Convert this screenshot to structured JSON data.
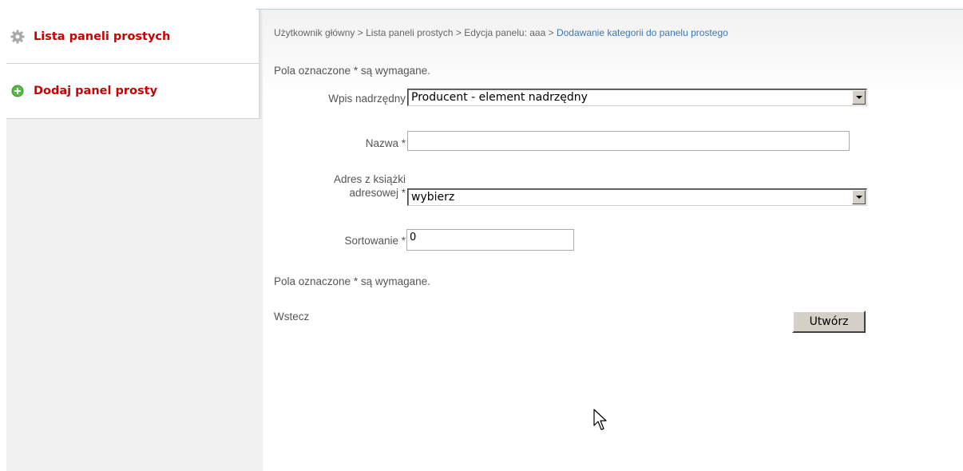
{
  "sidebar": {
    "items": [
      {
        "label": "Lista paneli prostych",
        "icon": "gear-icon"
      },
      {
        "label": "Dodaj panel prosty",
        "icon": "add-circle-icon"
      }
    ]
  },
  "breadcrumb": {
    "items": [
      "Użytkownik główny",
      "Lista paneli prostych",
      "Edycja panelu: aaa"
    ],
    "separator": ">",
    "current": "Dodawanie kategorii do panelu prostego"
  },
  "form": {
    "required_note_top": "Pola oznaczone * są wymagane.",
    "parent": {
      "label": "Wpis nadrzędny",
      "value": "Producent - element nadrzędny"
    },
    "name": {
      "label": "Nazwa *",
      "value": ""
    },
    "address": {
      "label_line1": "Adres z książki",
      "label_line2": "adresowej *",
      "value": "wybierz"
    },
    "sort": {
      "label": "Sortowanie *",
      "value": "0"
    },
    "required_note_bottom": "Pola oznaczone * są wymagane.",
    "back_label": "Wstecz",
    "submit_label": "Utwórz"
  },
  "colors": {
    "sidebar_link": "#cc0000",
    "breadcrumb_current": "#3a78b8",
    "accent_line": "#ffcc33",
    "add_icon": "#55bb44"
  }
}
